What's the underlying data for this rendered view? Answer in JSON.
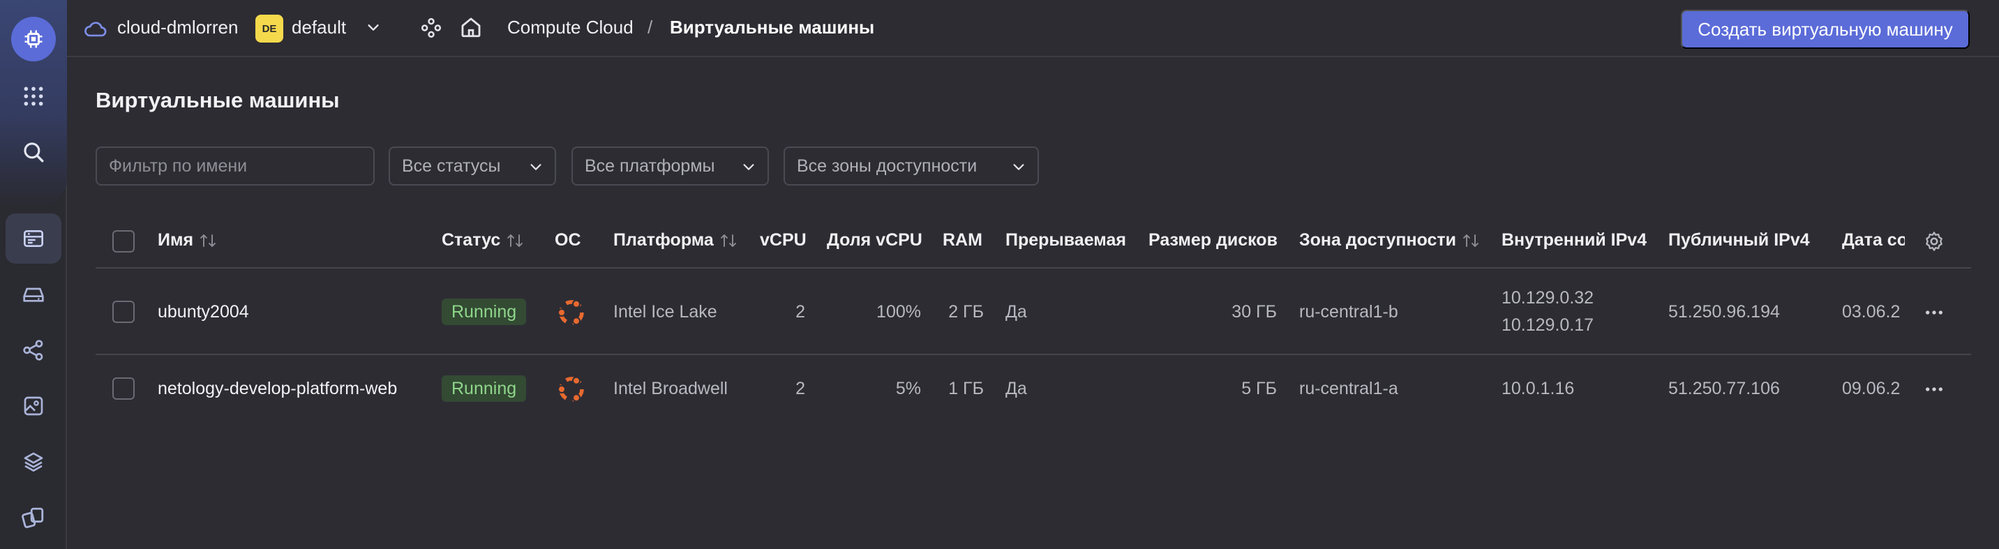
{
  "header": {
    "cloud_name": "cloud-dmlorren",
    "folder_badge": "DE",
    "folder_name": "default",
    "breadcrumb_service": "Compute Cloud",
    "breadcrumb_separator": "/",
    "breadcrumb_current": "Виртуальные машины",
    "create_button": "Создать виртуальную машину"
  },
  "sidebar": {
    "items": [
      {
        "icon": "logo-icon"
      },
      {
        "icon": "apps-grid-icon"
      },
      {
        "icon": "search-icon"
      },
      {
        "icon": "compute-icon",
        "active": true
      },
      {
        "icon": "disk-icon"
      },
      {
        "icon": "network-icon"
      },
      {
        "icon": "image-icon"
      },
      {
        "icon": "layers-icon"
      },
      {
        "icon": "snapshot-icon"
      }
    ]
  },
  "page": {
    "title": "Виртуальные машины",
    "filters": {
      "name_placeholder": "Фильтр по имени",
      "status": "Все статусы",
      "platform": "Все платформы",
      "zone": "Все зоны доступности"
    }
  },
  "table": {
    "columns": {
      "name": "Имя",
      "status": "Статус",
      "os": "ОС",
      "platform": "Платформа",
      "vcpu": "vCPU",
      "vcpu_share": "Доля vCPU",
      "ram": "RAM",
      "preemptible": "Прерываемая",
      "disk_size": "Размер дисков",
      "zone": "Зона доступности",
      "internal_ip": "Внутренний IPv4",
      "public_ip": "Публичный IPv4",
      "date": "Дата со"
    },
    "rows": [
      {
        "name": "ubunty2004",
        "status": "Running",
        "os": "ubuntu-icon",
        "platform": "Intel Ice Lake",
        "vcpu": "2",
        "vcpu_share": "100%",
        "ram": "2 ГБ",
        "preemptible": "Да",
        "disk_size": "30 ГБ",
        "zone": "ru-central1-b",
        "internal_ip_1": "10.129.0.32",
        "internal_ip_2": "10.129.0.17",
        "public_ip": "51.250.96.194",
        "date": "03.06.2"
      },
      {
        "name": "netology-develop-platform-web",
        "status": "Running",
        "os": "ubuntu-icon",
        "platform": "Intel Broadwell",
        "vcpu": "2",
        "vcpu_share": "5%",
        "ram": "1 ГБ",
        "preemptible": "Да",
        "disk_size": "5 ГБ",
        "zone": "ru-central1-a",
        "internal_ip_1": "10.0.1.16",
        "public_ip": "51.250.77.106",
        "date": "09.06.2"
      }
    ]
  },
  "colors": {
    "background": "#2d2c33",
    "accent": "#5b6cd8",
    "running_badge_bg": "#334a33",
    "running_badge_text": "#8fd68b",
    "ubuntu_orange": "#e8692f",
    "folder_badge": "#f5d94c"
  }
}
